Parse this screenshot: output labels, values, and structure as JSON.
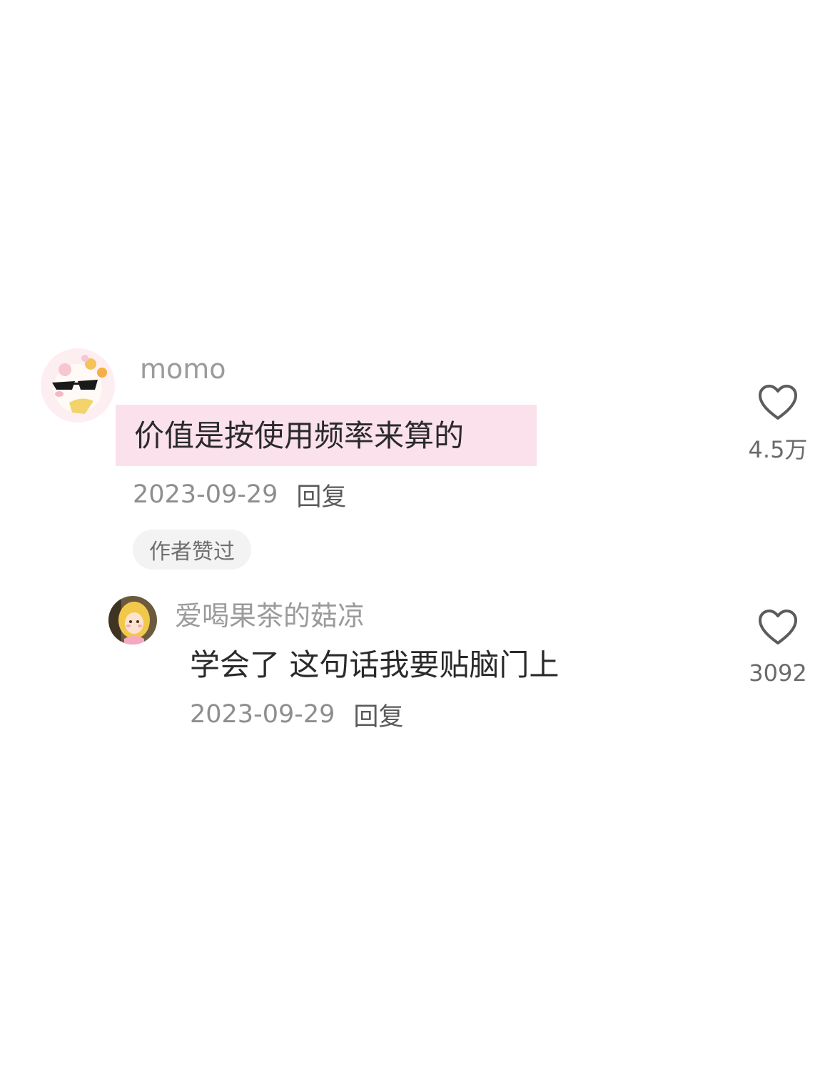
{
  "comments": [
    {
      "username": "momo",
      "text": "价值是按使用频率来算的",
      "date": "2023-09-29",
      "reply_label": "回复",
      "badge": "作者赞过",
      "likes": "4.5万",
      "avatar_icon": "sunglasses-character-avatar",
      "highlight_color": "#fbe1ec"
    },
    {
      "username": "爱喝果茶的菇凉",
      "text": "学会了 这句话我要贴脑门上",
      "date": "2023-09-29",
      "reply_label": "回复",
      "likes": "3092",
      "avatar_icon": "blonde-girl-avatar"
    }
  ],
  "icons": {
    "like": "heart-outline-icon"
  }
}
